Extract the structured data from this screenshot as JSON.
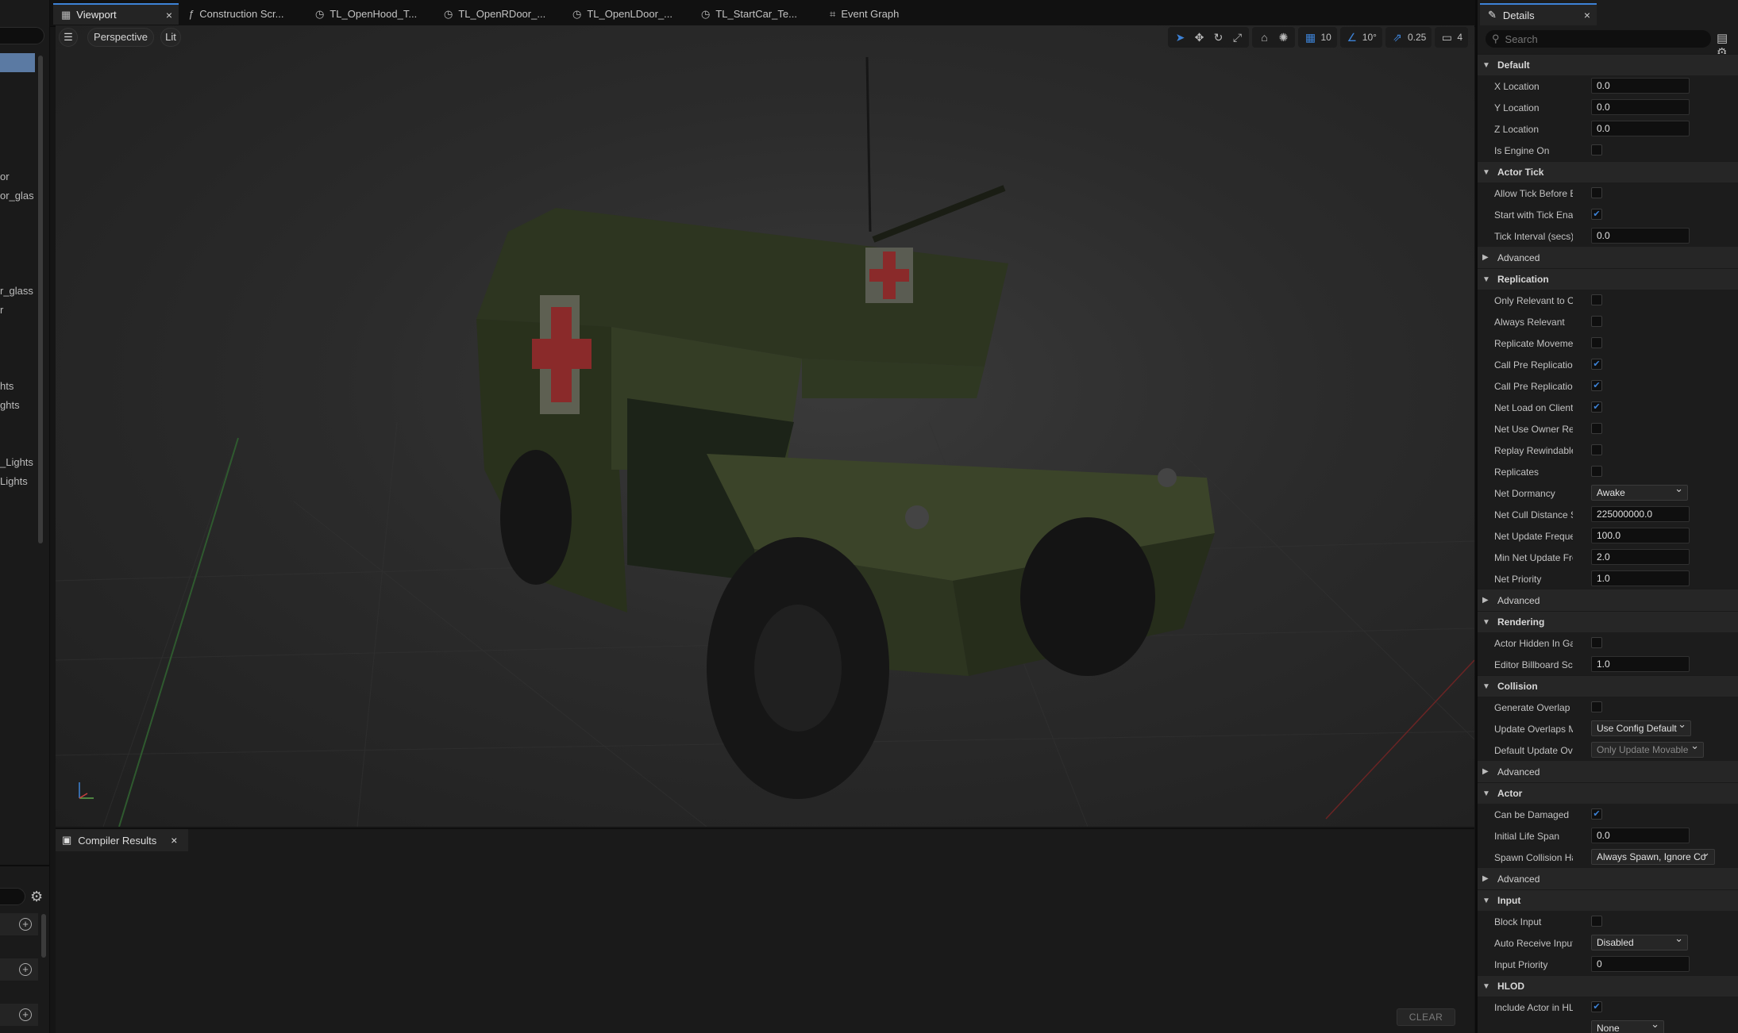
{
  "left_panel": {
    "items": [
      "or",
      "or_glas",
      "r_glass",
      "r",
      "hts",
      "ghts",
      "_Lights",
      "Lights"
    ]
  },
  "tabs": [
    {
      "label": "Viewport",
      "icon": "viewport-icon",
      "active": true,
      "closable": true
    },
    {
      "label": "Construction Scr...",
      "icon": "function-icon"
    },
    {
      "label": "TL_OpenHood_T...",
      "icon": "clock-icon"
    },
    {
      "label": "TL_OpenRDoor_...",
      "icon": "clock-icon"
    },
    {
      "label": "TL_OpenLDoor_...",
      "icon": "clock-icon"
    },
    {
      "label": "TL_StartCar_Te...",
      "icon": "clock-icon"
    },
    {
      "label": "Event Graph",
      "icon": "graph-icon"
    }
  ],
  "viewport": {
    "menu_icon": "hamburger-icon",
    "perspective_label": "Perspective",
    "lit_label": "Lit",
    "grid_snap": "10",
    "rotation_snap": "10°",
    "scale_snap": "0.25",
    "camera_speed": "4"
  },
  "bottom": {
    "tab_label": "Compiler Results",
    "clear_label": "CLEAR"
  },
  "details": {
    "tab_label": "Details",
    "search_placeholder": "Search",
    "sections": [
      {
        "type": "cat",
        "label": "Default"
      },
      {
        "type": "prop",
        "label": "X Location",
        "kind": "text",
        "value": "0.0"
      },
      {
        "type": "prop",
        "label": "Y Location",
        "kind": "text",
        "value": "0.0"
      },
      {
        "type": "prop",
        "label": "Z Location",
        "kind": "text",
        "value": "0.0"
      },
      {
        "type": "prop",
        "label": "Is Engine On",
        "kind": "check",
        "checked": false
      },
      {
        "type": "cat",
        "label": "Actor Tick"
      },
      {
        "type": "prop",
        "label": "Allow Tick Before B...",
        "kind": "check",
        "checked": false
      },
      {
        "type": "prop",
        "label": "Start with Tick Ena...",
        "kind": "check",
        "checked": true
      },
      {
        "type": "prop",
        "label": "Tick Interval (secs)",
        "kind": "text",
        "value": "0.0"
      },
      {
        "type": "adv",
        "label": "Advanced"
      },
      {
        "type": "cat",
        "label": "Replication"
      },
      {
        "type": "prop",
        "label": "Only Relevant to O...",
        "kind": "check",
        "checked": false
      },
      {
        "type": "prop",
        "label": "Always Relevant",
        "kind": "check",
        "checked": false
      },
      {
        "type": "prop",
        "label": "Replicate Movement",
        "kind": "check",
        "checked": false
      },
      {
        "type": "prop",
        "label": "Call Pre Replication",
        "kind": "check",
        "checked": true
      },
      {
        "type": "prop",
        "label": "Call Pre Replication...",
        "kind": "check",
        "checked": true
      },
      {
        "type": "prop",
        "label": "Net Load on Client",
        "kind": "check",
        "checked": true
      },
      {
        "type": "prop",
        "label": "Net Use Owner Rel...",
        "kind": "check",
        "checked": false
      },
      {
        "type": "prop",
        "label": "Replay Rewindable",
        "kind": "check",
        "checked": false
      },
      {
        "type": "prop",
        "label": "Replicates",
        "kind": "check",
        "checked": false
      },
      {
        "type": "prop",
        "label": "Net Dormancy",
        "kind": "dropdown",
        "value": "Awake",
        "width": 122
      },
      {
        "type": "prop",
        "label": "Net Cull Distance S...",
        "kind": "text",
        "value": "225000000.0"
      },
      {
        "type": "prop",
        "label": "Net Update Frequen...",
        "kind": "text",
        "value": "100.0"
      },
      {
        "type": "prop",
        "label": "Min Net Update Fre...",
        "kind": "text",
        "value": "2.0"
      },
      {
        "type": "prop",
        "label": "Net Priority",
        "kind": "text",
        "value": "1.0"
      },
      {
        "type": "adv",
        "label": "Advanced"
      },
      {
        "type": "cat",
        "label": "Rendering"
      },
      {
        "type": "prop",
        "label": "Actor Hidden In Ga...",
        "kind": "check",
        "checked": false
      },
      {
        "type": "prop",
        "label": "Editor Billboard Scale",
        "kind": "text",
        "value": "1.0"
      },
      {
        "type": "cat",
        "label": "Collision"
      },
      {
        "type": "prop",
        "label": "Generate Overlap E...",
        "kind": "check",
        "checked": false
      },
      {
        "type": "prop",
        "label": "Update Overlaps M...",
        "kind": "dropdown",
        "value": "Use Config Default",
        "width": 126
      },
      {
        "type": "prop",
        "label": "Default Update Ove...",
        "kind": "dropdown",
        "value": "Only Update Movable",
        "width": 142,
        "disabled": true
      },
      {
        "type": "adv",
        "label": "Advanced"
      },
      {
        "type": "cat",
        "label": "Actor"
      },
      {
        "type": "prop",
        "label": "Can be Damaged",
        "kind": "check",
        "checked": true
      },
      {
        "type": "prop",
        "label": "Initial Life Span",
        "kind": "text",
        "value": "0.0"
      },
      {
        "type": "prop",
        "label": "Spawn Collision Ha...",
        "kind": "dropdown",
        "value": "Always Spawn, Ignore Co",
        "width": 156
      },
      {
        "type": "adv",
        "label": "Advanced"
      },
      {
        "type": "cat",
        "label": "Input"
      },
      {
        "type": "prop",
        "label": "Block Input",
        "kind": "check",
        "checked": false
      },
      {
        "type": "prop",
        "label": "Auto Receive Input",
        "kind": "dropdown",
        "value": "Disabled",
        "width": 122
      },
      {
        "type": "prop",
        "label": "Input Priority",
        "kind": "text",
        "value": "0"
      },
      {
        "type": "cat",
        "label": "HLOD"
      },
      {
        "type": "prop",
        "label": "Include Actor in HL...",
        "kind": "check",
        "checked": true
      },
      {
        "type": "prop",
        "label": "",
        "kind": "dropdown",
        "value": "None",
        "width": 92
      }
    ]
  }
}
